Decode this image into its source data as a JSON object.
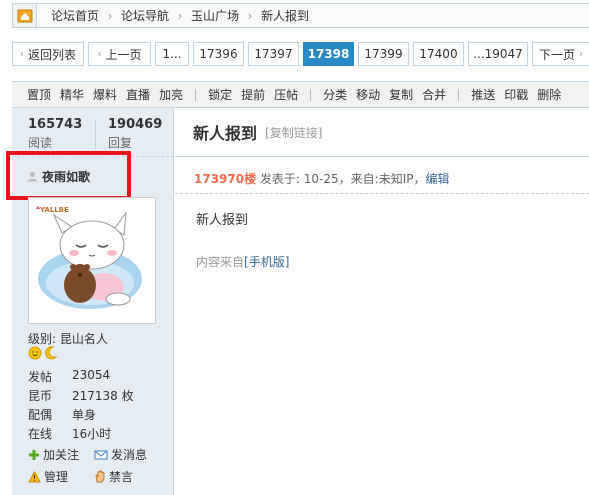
{
  "breadcrumb": {
    "items": [
      "论坛首页",
      "论坛导航",
      "玉山广场",
      "新人报到"
    ],
    "separator": "›"
  },
  "pager": {
    "back_label": "返回列表",
    "prev_label": "上一页",
    "first_label": "1...",
    "pages": [
      "17396",
      "17397",
      "17398",
      "17399",
      "17400"
    ],
    "current": "17398",
    "last_label": "...19047",
    "next_label": "下一页"
  },
  "modbar": {
    "group1": [
      "置顶",
      "精华",
      "爆料",
      "直播",
      "加亮"
    ],
    "group2": [
      "锁定",
      "提前",
      "压帖"
    ],
    "group3": [
      "分类",
      "移动",
      "复制",
      "合并"
    ],
    "group4": [
      "推送",
      "印戳",
      "删除"
    ]
  },
  "user": {
    "views_value": "165743",
    "views_label": "阅读",
    "replies_value": "190469",
    "replies_label": "回复",
    "name": "夜雨如歌",
    "avatar_text": "YALLBE",
    "level_label": "级别:",
    "level_value": "昆山名人",
    "details": [
      {
        "k": "发帖",
        "v": "23054"
      },
      {
        "k": "昆币",
        "v": "217138 枚"
      },
      {
        "k": "配偶",
        "v": "单身"
      },
      {
        "k": "在线",
        "v": "16小时"
      }
    ],
    "follow_label": "加关注",
    "message_label": "发消息",
    "manage_label": "管理",
    "ban_label": "禁言"
  },
  "post": {
    "title": "新人报到",
    "copy_link_label": "[复制链接]",
    "floor": "173970楼",
    "meta_text": " 发表于: 10-25，来自:未知IP，",
    "edit_label": "编辑",
    "body": "新人报到",
    "source_prefix": "内容来自",
    "source_link": "[手机版]"
  },
  "colors": {
    "accent": "#2a8ac6",
    "border": "#c2d5e3",
    "sidebar_bg": "#e5edf2",
    "highlight_box": "#e8141c",
    "floor": "#f26c4f"
  }
}
